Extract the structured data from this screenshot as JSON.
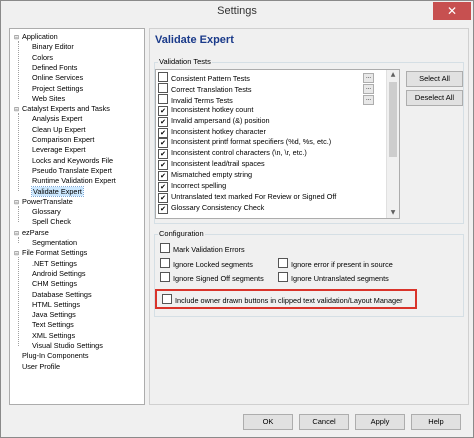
{
  "window": {
    "title": "Settings",
    "close_glyph": "✕"
  },
  "tree": {
    "nodes": [
      {
        "label": "Application",
        "level": 0,
        "toggle": "⊟"
      },
      {
        "label": "Binary Editor",
        "level": 1
      },
      {
        "label": "Colors",
        "level": 1
      },
      {
        "label": "Defined Fonts",
        "level": 1
      },
      {
        "label": "Online Services",
        "level": 1
      },
      {
        "label": "Project Settings",
        "level": 1
      },
      {
        "label": "Web Sites",
        "level": 1
      },
      {
        "label": "Catalyst Experts and Tasks",
        "level": 0,
        "toggle": "⊟"
      },
      {
        "label": "Analysis Expert",
        "level": 1
      },
      {
        "label": "Clean Up Expert",
        "level": 1
      },
      {
        "label": "Comparison Expert",
        "level": 1
      },
      {
        "label": "Leverage Expert",
        "level": 1
      },
      {
        "label": "Locks and Keywords File",
        "level": 1
      },
      {
        "label": "Pseudo Translate Expert",
        "level": 1
      },
      {
        "label": "Runtime Validation Expert",
        "level": 1
      },
      {
        "label": "Validate Expert",
        "level": 1,
        "selected": true
      },
      {
        "label": "PowerTranslate",
        "level": 0,
        "toggle": "⊟"
      },
      {
        "label": "Glossary",
        "level": 1
      },
      {
        "label": "Spell Check",
        "level": 1
      },
      {
        "label": "ezParse",
        "level": 0,
        "toggle": "⊟"
      },
      {
        "label": "Segmentation",
        "level": 1
      },
      {
        "label": "File Format Settings",
        "level": 0,
        "toggle": "⊟"
      },
      {
        "label": ".NET Settings",
        "level": 1
      },
      {
        "label": "Android Settings",
        "level": 1
      },
      {
        "label": "CHM Settings",
        "level": 1
      },
      {
        "label": "Database Settings",
        "level": 1
      },
      {
        "label": "HTML Settings",
        "level": 1
      },
      {
        "label": "Java Settings",
        "level": 1
      },
      {
        "label": "Text Settings",
        "level": 1
      },
      {
        "label": "XML Settings",
        "level": 1
      },
      {
        "label": "Visual Studio Settings",
        "level": 1
      },
      {
        "label": "Plug-In Components",
        "level": 0
      },
      {
        "label": "User Profile",
        "level": 0
      }
    ]
  },
  "panel": {
    "heading": "Validate Expert",
    "tests_group_title": "Validation Tests",
    "tests": [
      {
        "label": "Consistent Pattern Tests",
        "checked": false,
        "has_options": true
      },
      {
        "label": "Correct Translation Tests",
        "checked": false,
        "has_options": true
      },
      {
        "label": "Invalid Terms Tests",
        "checked": false,
        "has_options": true
      },
      {
        "label": "Inconsistent hotkey count",
        "checked": true
      },
      {
        "label": "Invalid ampersand (&) position",
        "checked": true
      },
      {
        "label": "Inconsistent hotkey character",
        "checked": true
      },
      {
        "label": "Inconsistent printf format specifiers (%d, %s, etc.)",
        "checked": true
      },
      {
        "label": "Inconsistent control characters (\\n, \\r, etc.)",
        "checked": true
      },
      {
        "label": "Inconsistent lead/trail spaces",
        "checked": true
      },
      {
        "label": "Mismatched empty string",
        "checked": true
      },
      {
        "label": "Incorrect spelling",
        "checked": true
      },
      {
        "label": "Untranslated text marked For Review or Signed Off",
        "checked": true
      },
      {
        "label": "Glossary Consistency Check",
        "checked": true
      }
    ],
    "ellipsis": "...",
    "select_all": "Select All",
    "deselect_all": "Deselect All",
    "config_group_title": "Configuration",
    "config": {
      "mark_validation_errors": "Mark Validation Errors",
      "ignore_locked": "Ignore Locked segments",
      "ignore_error_source": "Ignore error if present in source",
      "ignore_signed_off": "Ignore Signed Off segments",
      "ignore_untranslated": "Ignore Untranslated segments",
      "owner_drawn": "Include owner drawn buttons in clipped text validation/Layout Manager"
    }
  },
  "buttons": {
    "ok": "OK",
    "cancel": "Cancel",
    "apply": "Apply",
    "help": "Help"
  },
  "colors": {
    "highlight": "#d9342b",
    "heading": "#1a3a8a",
    "selection": "#cce8ff",
    "close": "#c75050"
  }
}
